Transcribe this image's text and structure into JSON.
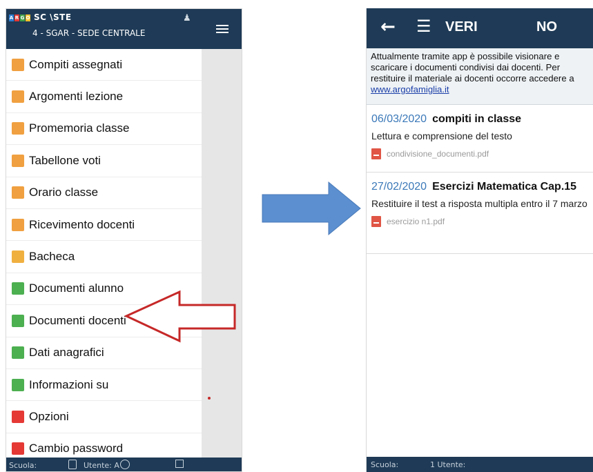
{
  "left_app": {
    "logo_letters": [
      "A",
      "R",
      "G",
      "O"
    ],
    "logo_colors": [
      "#2e7dd1",
      "#e53935",
      "#43a047",
      "#fbc02d"
    ],
    "school_name": "SC          \\STE",
    "school_sub": "4 - SGAR - SEDE CENTRALE",
    "menu_items": [
      {
        "label": "Compiti assegnati",
        "icon": "homework-icon",
        "color": "#f0a040"
      },
      {
        "label": "Argomenti lezione",
        "icon": "lesson-topics-icon",
        "color": "#f0a040"
      },
      {
        "label": "Promemoria classe",
        "icon": "class-reminder-icon",
        "color": "#f0a040"
      },
      {
        "label": "Tabellone voti",
        "icon": "grades-board-icon",
        "color": "#f0a040"
      },
      {
        "label": "Orario classe",
        "icon": "class-schedule-icon",
        "color": "#f0a040"
      },
      {
        "label": "Ricevimento docenti",
        "icon": "teacher-reception-icon",
        "color": "#f0a040"
      },
      {
        "label": "Bacheca",
        "icon": "noticeboard-icon",
        "color": "#f0b040"
      },
      {
        "label": "Documenti alunno",
        "icon": "student-documents-icon",
        "color": "#4caf50"
      },
      {
        "label": "Documenti docenti",
        "icon": "teacher-documents-icon",
        "color": "#4caf50"
      },
      {
        "label": "Dati anagrafici",
        "icon": "personal-data-icon",
        "color": "#4caf50"
      },
      {
        "label": "Informazioni su",
        "icon": "info-icon",
        "color": "#4caf50"
      },
      {
        "label": "Opzioni",
        "icon": "options-icon",
        "color": "#e53935"
      },
      {
        "label": "Cambio password",
        "icon": "change-password-icon",
        "color": "#e53935"
      }
    ],
    "status": {
      "school": "Scuola:",
      "user": "Utente: A"
    }
  },
  "right_app": {
    "title_a": "VERI",
    "title_b": "NO",
    "info_text": "Attualmente tramite app è possibile visionare e scaricare i documenti condivisi dai docenti. Per restituire il materiale ai docenti occorre accedere a ",
    "info_link": "www.argofamiglia.it",
    "documents": [
      {
        "date": "06/03/2020",
        "title": "compiti in classe",
        "description": "Lettura e comprensione del testo",
        "file": "condivisione_documenti.pdf"
      },
      {
        "date": "27/02/2020",
        "title": "Esercizi Matematica Cap.15",
        "description": "Restituire il test a risposta multipla entro il 7 marzo",
        "file": "esercizio n1.pdf"
      }
    ],
    "status": {
      "school": "Scuola:",
      "user": "1 Utente:"
    }
  },
  "colors": {
    "header": "#1e3a56",
    "arrow_red": "#c62828",
    "arrow_blue": "#5b8fd0"
  }
}
